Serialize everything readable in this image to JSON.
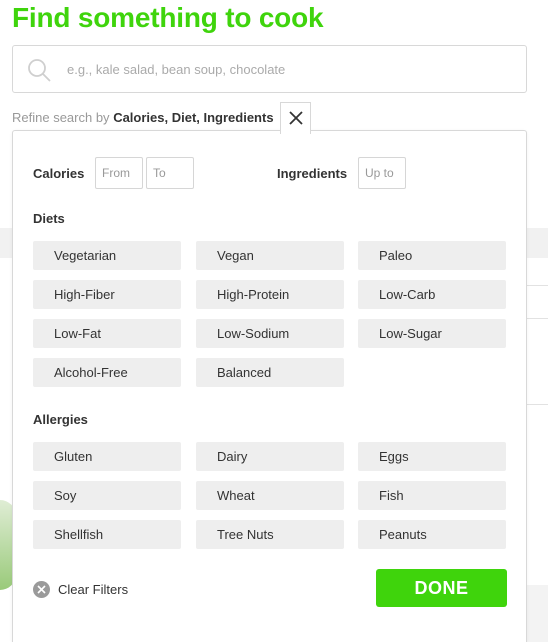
{
  "header": {
    "title": "Find something to cook"
  },
  "search": {
    "placeholder": "e.g., kale salad, bean soup, chocolate",
    "value": ""
  },
  "refine": {
    "prefix": "Refine search by",
    "options": "Calories, Diet, Ingredients"
  },
  "filters": {
    "calories_label": "Calories",
    "calories_from_placeholder": "From",
    "calories_to_placeholder": "To",
    "ingredients_label": "Ingredients",
    "ingredients_placeholder": "Up to",
    "diets_title": "Diets",
    "diets": [
      "Vegetarian",
      "Vegan",
      "Paleo",
      "High-Fiber",
      "High-Protein",
      "Low-Carb",
      "Low-Fat",
      "Low-Sodium",
      "Low-Sugar",
      "Alcohol-Free",
      "Balanced"
    ],
    "allergies_title": "Allergies",
    "allergies": [
      "Gluten",
      "Dairy",
      "Eggs",
      "Soy",
      "Wheat",
      "Fish",
      "Shellfish",
      "Tree Nuts",
      "Peanuts"
    ],
    "clear_label": "Clear Filters",
    "done_label": "DONE"
  },
  "colors": {
    "accent": "#3fd40c",
    "chip_bg": "#eeeeee",
    "text": "#333333",
    "muted": "#999999"
  },
  "icons": {
    "search": "search-icon",
    "close": "close-icon",
    "clear": "clear-circle-icon"
  }
}
